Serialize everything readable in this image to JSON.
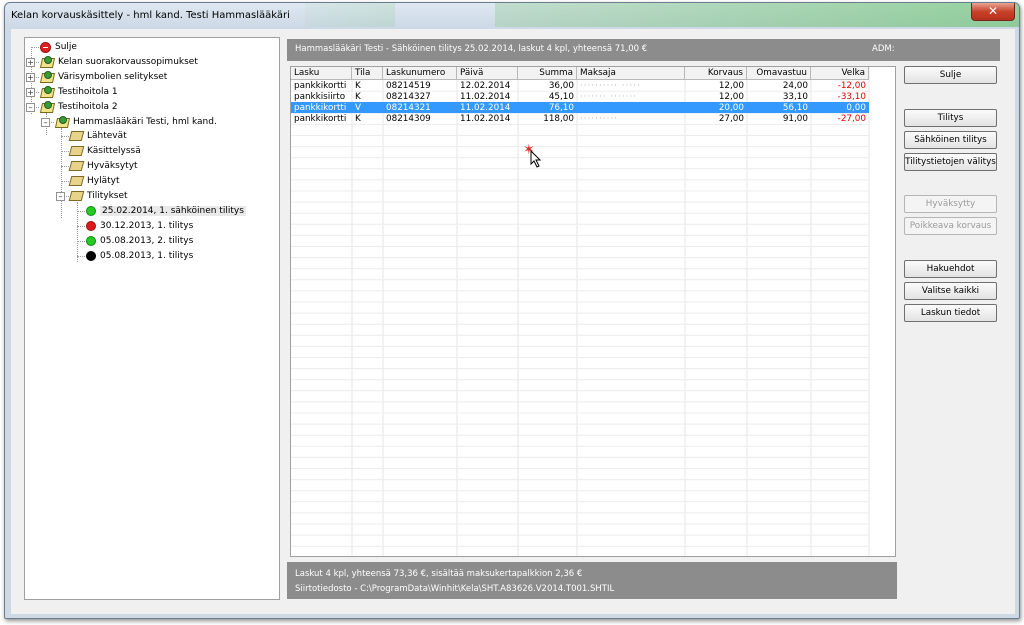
{
  "window": {
    "title": "Kelan korvauskäsittely  -  hml kand. Testi Hammaslääkäri",
    "close_symbol": "✕"
  },
  "tree": {
    "items": [
      {
        "label": "Sulje",
        "icon": "stop-icon"
      },
      {
        "label": "Kelan suorakorvaussopimukset",
        "icon": "certificate-icon"
      },
      {
        "label": "Värisymbolien selitykset",
        "icon": "certificate-icon"
      },
      {
        "label": "Testihoitola 1",
        "icon": "certificate-icon"
      },
      {
        "label": "Testihoitola 2",
        "icon": "certificate-icon"
      },
      {
        "label": "Hammaslääkäri Testi, hml kand.",
        "icon": "certificate-icon"
      },
      {
        "label": "Lähtevät",
        "icon": "folder-icon"
      },
      {
        "label": "Käsittelyssä",
        "icon": "folder-icon"
      },
      {
        "label": "Hyväksytyt",
        "icon": "folder-icon"
      },
      {
        "label": "Hylätyt",
        "icon": "folder-icon"
      },
      {
        "label": "Tilitykset",
        "icon": "folder-icon"
      },
      {
        "label": "25.02.2014, 1. sähköinen tilitys",
        "icon": "status-dot-icon",
        "color": "#22cc22"
      },
      {
        "label": "30.12.2013, 1. tilitys",
        "icon": "status-dot-icon",
        "color": "#e01818"
      },
      {
        "label": "05.08.2013, 2. tilitys",
        "icon": "status-dot-icon",
        "color": "#22cc22"
      },
      {
        "label": "05.08.2013, 1. tilitys",
        "icon": "status-dot-icon",
        "color": "#000000"
      }
    ]
  },
  "header": {
    "text": "Hammaslääkäri Testi  -  Sähköinen tilitys 25.02.2014, laskut 4 kpl, yhteensä 71,00 €",
    "adm": "ADM:"
  },
  "table": {
    "columns": [
      "Lasku",
      "Tila",
      "Laskunumero",
      "Päivä",
      "Summa",
      "Maksaja",
      "Korvaus",
      "Omavastuu",
      "Velka"
    ],
    "rows": [
      {
        "lasku": "pankkikortti",
        "tila": "K",
        "laskunumero": "08214519",
        "paiva": "12.02.2014",
        "summa": "36,00",
        "maksaja": "··········  ·····",
        "korvaus": "12,00",
        "omavastuu": "24,00",
        "velka": "-12,00",
        "selected": false
      },
      {
        "lasku": "pankkisiirto",
        "tila": "K",
        "laskunumero": "08214327",
        "paiva": "11.02.2014",
        "summa": "45,10",
        "maksaja": "·······  ·······",
        "korvaus": "12,00",
        "omavastuu": "33,10",
        "velka": "-33,10",
        "selected": false
      },
      {
        "lasku": "pankkikortti",
        "tila": "V",
        "laskunumero": "08214321",
        "paiva": "11.02.2014",
        "summa": "76,10",
        "maksaja": "",
        "korvaus": "20,00",
        "omavastuu": "56,10",
        "velka": "0,00",
        "selected": true
      },
      {
        "lasku": "pankkikortti",
        "tila": "K",
        "laskunumero": "08214309",
        "paiva": "11.02.2014",
        "summa": "118,00",
        "maksaja": "··········",
        "korvaus": "27,00",
        "omavastuu": "91,00",
        "velka": "-27,00",
        "selected": false
      }
    ]
  },
  "footer": {
    "line1": "Laskut 4 kpl, yhteensä 73,36 €, sisältää maksukertapalkkion 2,36 €",
    "line2": "Siirtotiedosto  -  C:\\ProgramData\\Winhit\\Kela\\SHT.A83626.V2014.T001.SHTIL"
  },
  "buttons": {
    "sulje": "Sulje",
    "tilitys": "Tilitys",
    "sahkoinen_tilitys": "Sähköinen tilitys",
    "tilitystietojen_valitys": "Tilitystietojen välitys",
    "hyvaksytty": "Hyväksytty",
    "poikkeava_korvaus": "Poikkeava korvaus",
    "hakuehdot": "Hakuehdot",
    "valitse_kaikki": "Valitse kaikki",
    "laskun_tiedot": "Laskun tiedot"
  },
  "colors": {
    "selection": "#3399ff",
    "negative": "#e00000",
    "bar": "#8c8c8c"
  }
}
